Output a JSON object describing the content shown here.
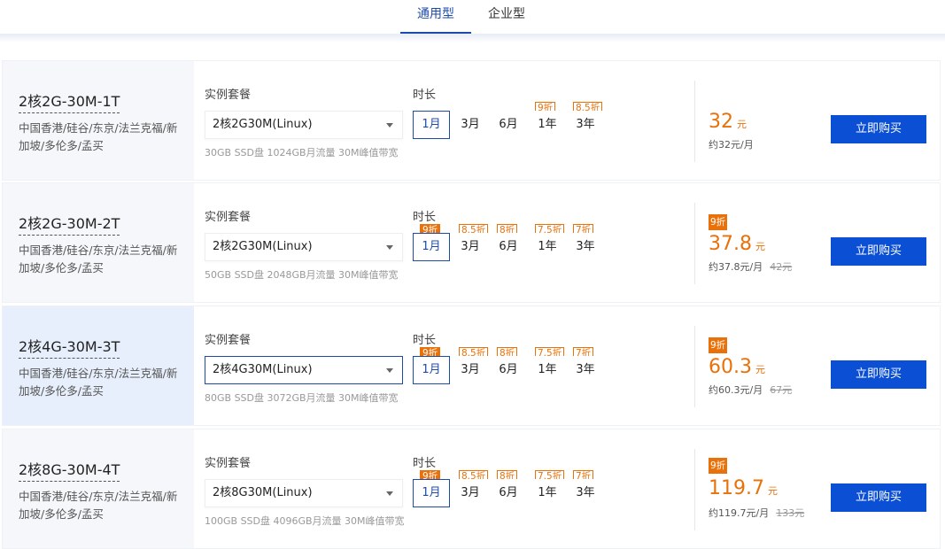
{
  "tabs": [
    {
      "label": "通用型",
      "active": true
    },
    {
      "label": "企业型",
      "active": false
    }
  ],
  "labels": {
    "package": "实例套餐",
    "duration": "时长",
    "buy": "立即购买",
    "currency_unit": "元"
  },
  "durations": [
    "1月",
    "3月",
    "6月",
    "1年",
    "3年"
  ],
  "cards": [
    {
      "title": "2核2G-30M-1T",
      "desc": "中国香港/硅谷/东京/法兰克福/新加坡/多伦多/孟买",
      "package": "2核2G30M(Linux)",
      "spec": "30GB SSD盘 1024GB月流量 30M峰值带宽",
      "discounts": [
        "",
        "",
        "",
        "9折",
        "8.5折"
      ],
      "badge": "",
      "price": "32",
      "per_month": "约32元/月",
      "original": ""
    },
    {
      "title": "2核2G-30M-2T",
      "desc": "中国香港/硅谷/东京/法兰克福/新加坡/多伦多/孟买",
      "package": "2核2G30M(Linux)",
      "spec": "50GB SSD盘 2048GB月流量 30M峰值带宽",
      "discounts": [
        "9折",
        "8.5折",
        "8折",
        "7.5折",
        "7折"
      ],
      "badge": "9折",
      "price": "37.8",
      "per_month": "约37.8元/月",
      "original": "42元"
    },
    {
      "title": "2核4G-30M-3T",
      "desc": "中国香港/硅谷/东京/法兰克福/新加坡/多伦多/孟买",
      "package": "2核4G30M(Linux)",
      "spec": "80GB SSD盘 3072GB月流量 30M峰值带宽",
      "discounts": [
        "9折",
        "8.5折",
        "8折",
        "7.5折",
        "7折"
      ],
      "badge": "9折",
      "price": "60.3",
      "per_month": "约60.3元/月",
      "original": "67元"
    },
    {
      "title": "2核8G-30M-4T",
      "desc": "中国香港/硅谷/东京/法兰克福/新加坡/多伦多/孟买",
      "package": "2核8G30M(Linux)",
      "spec": "100GB SSD盘 4096GB月流量 30M峰值带宽",
      "discounts": [
        "9折",
        "8.5折",
        "8折",
        "7.5折",
        "7折"
      ],
      "badge": "9折",
      "price": "119.7",
      "per_month": "约119.7元/月",
      "original": "133元"
    }
  ],
  "colors": {
    "accent": "#1f4ba8",
    "button": "#0b4fd4",
    "discount": "#e8710a"
  }
}
